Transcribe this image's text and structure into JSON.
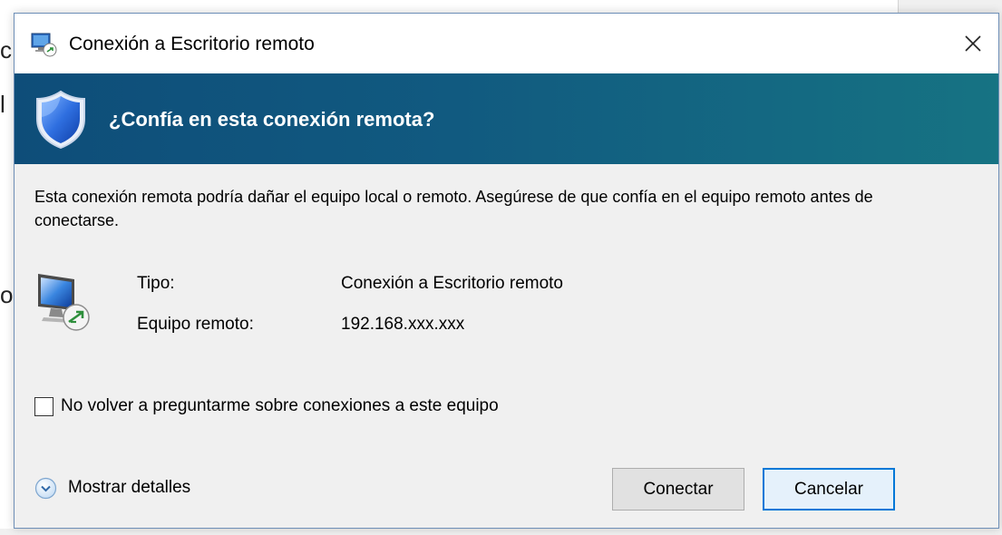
{
  "dialog": {
    "title": "Conexión a Escritorio remoto",
    "banner_heading": "¿Confía en esta conexión remota?",
    "description": "Esta conexión remota podría dañar el equipo local o remoto. Asegúrese de que confía en el equipo remoto antes de conectarse.",
    "info": {
      "type_label": "Tipo:",
      "type_value": "Conexión a Escritorio remoto",
      "remote_label": "Equipo remoto:",
      "remote_value": "192.168.xxx.xxx"
    },
    "checkbox": {
      "label": "No volver a preguntarme sobre conexiones a este equipo",
      "checked": false
    },
    "details_label": "Mostrar detalles",
    "buttons": {
      "connect": "Conectar",
      "cancel": "Cancelar"
    }
  },
  "icons": [
    "rdp-app-icon",
    "close-icon",
    "shield-icon",
    "remote-computer-icon",
    "chevron-down-icon"
  ],
  "colors": {
    "banner_start": "#0e4d79",
    "banner_end": "#167383",
    "dialog_bg": "#f0f0f0",
    "focus_border": "#0078d7"
  }
}
